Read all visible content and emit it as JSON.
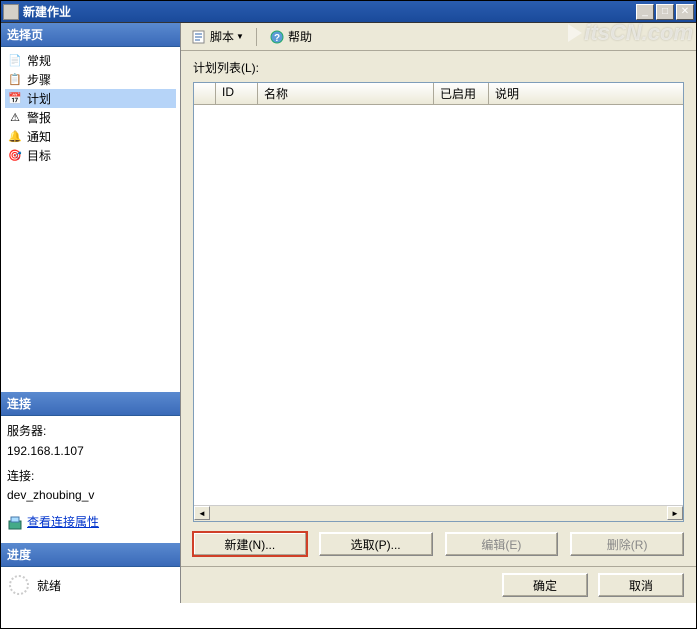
{
  "window": {
    "title": "新建作业"
  },
  "watermark": {
    "text": "itsCN.com"
  },
  "sidebar": {
    "select_header": "选择页",
    "nav": [
      {
        "label": "常规",
        "icon": "📄"
      },
      {
        "label": "步骤",
        "icon": "📋"
      },
      {
        "label": "计划",
        "icon": "📅",
        "selected": true
      },
      {
        "label": "警报",
        "icon": "⚠"
      },
      {
        "label": "通知",
        "icon": "🔔"
      },
      {
        "label": "目标",
        "icon": "🎯"
      }
    ],
    "conn_header": "连接",
    "server_label": "服务器:",
    "server_value": "192.168.1.107",
    "conn_label": "连接:",
    "conn_value": "dev_zhoubing_v",
    "view_props": "查看连接属性",
    "progress_header": "进度",
    "progress_status": "就绪"
  },
  "toolbar": {
    "script_label": "脚本",
    "help_label": "帮助"
  },
  "content": {
    "list_label": "计划列表(L):",
    "columns": {
      "id": "ID",
      "name": "名称",
      "enabled": "已启用",
      "desc": "说明"
    },
    "buttons": {
      "new": "新建(N)...",
      "pick": "选取(P)...",
      "edit": "编辑(E)",
      "delete": "删除(R)"
    }
  },
  "dialog": {
    "ok": "确定",
    "cancel": "取消"
  }
}
